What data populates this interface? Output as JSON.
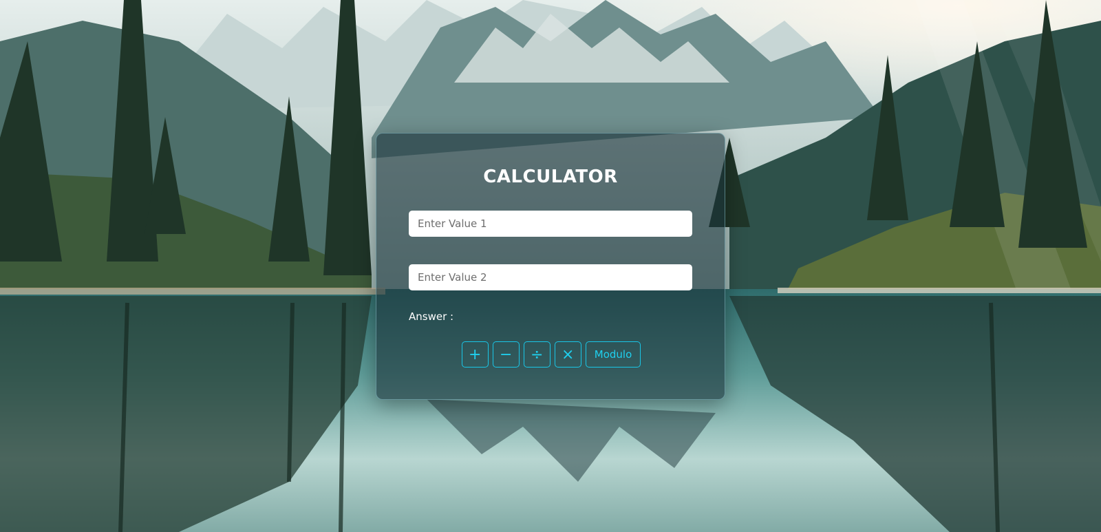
{
  "calculator": {
    "title": "CALCULATOR",
    "value1_placeholder": "Enter Value 1",
    "value2_placeholder": "Enter Value 2",
    "value1": "",
    "value2": "",
    "answer_label": "Answer :",
    "operations": {
      "add": "+",
      "subtract": "−",
      "divide": "÷",
      "multiply": "×",
      "modulo": "Modulo"
    }
  },
  "colors": {
    "accent": "#19c7e8",
    "card_background": "#1c343a",
    "title_text": "#ffffff"
  },
  "background": {
    "description_icon": "mountain-lake-landscape"
  }
}
